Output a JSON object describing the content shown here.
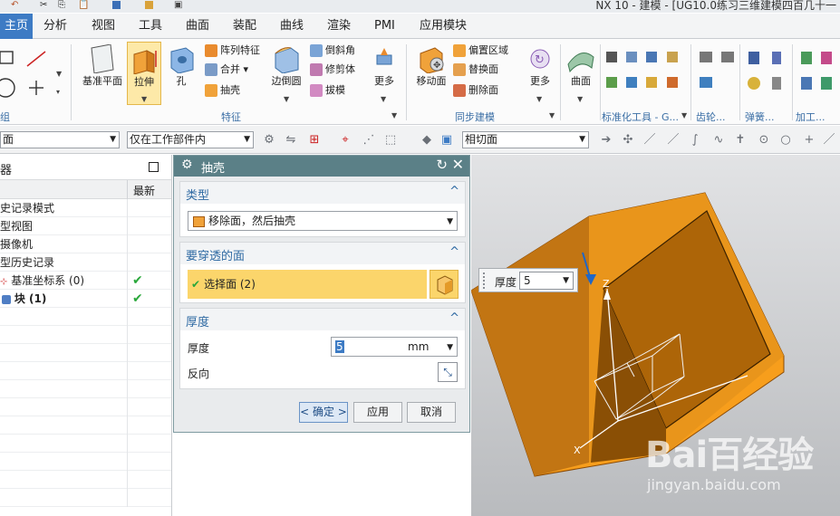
{
  "window": {
    "title": "NX 10 - 建模 - [UG10.0练习三维建模四百几十一"
  },
  "menu_tabs": [
    {
      "label": "主页",
      "active": true
    },
    {
      "label": "分析"
    },
    {
      "label": "视图"
    },
    {
      "label": "工具"
    },
    {
      "label": "曲面"
    },
    {
      "label": "装配"
    },
    {
      "label": "曲线"
    },
    {
      "label": "渲染"
    },
    {
      "label": "PMI"
    },
    {
      "label": "应用模块"
    }
  ],
  "ribbon": {
    "datum_plane": "基准平面",
    "extrude": "拉伸",
    "hole": "孔",
    "pattern_feature": "阵列特征",
    "unite": "合并",
    "shell": "抽壳",
    "edge_blend": "边倒圆",
    "chamfer": "倒斜角",
    "trim_body": "修剪体",
    "draft": "拔模",
    "more1": "更多",
    "group_feature": "特征",
    "move_face": "移动面",
    "offset_region": "偏置区域",
    "replace_face": "替换面",
    "delete_face": "删除面",
    "more2": "更多",
    "group_sync": "同步建模",
    "surface": "曲面",
    "group_std_parts": "标准化工具 - G...",
    "group_gear": "齿轮...",
    "group_spring": "弹簧...",
    "group_process": "加工...",
    "group_direct": "组"
  },
  "filterbar": {
    "type_filter": "面",
    "scope_filter": "仅在工作部件内",
    "face_rule": "相切面"
  },
  "navigator": {
    "title": "器",
    "col_latest": "最新",
    "rows": [
      {
        "label": "史记录模式",
        "check": ""
      },
      {
        "label": "型视图",
        "check": ""
      },
      {
        "label": "摄像机",
        "check": ""
      },
      {
        "label": "型历史记录",
        "check": ""
      },
      {
        "label": "基准坐标系 (0)",
        "check": "✔"
      },
      {
        "label": "块 (1)",
        "check": "✔"
      }
    ]
  },
  "dialog": {
    "title": "抽壳",
    "sec_type": "类型",
    "type_value": "移除面，然后抽壳",
    "sec_faces": "要穿透的面",
    "select_face": "选择面 (2)",
    "sec_thickness": "厚度",
    "thickness_label": "厚度",
    "thickness_value": "5",
    "thickness_unit": "mm",
    "reverse_label": "反向",
    "ok": "< 确定 >",
    "apply": "应用",
    "cancel": "取消"
  },
  "viewport": {
    "popup_label": "厚度",
    "popup_value": "5",
    "axis_z": "Z",
    "axis_x": "X"
  },
  "watermark": {
    "brand": "Bai百经验",
    "url": "jingyan.baidu.com"
  },
  "colors": {
    "accent": "#3d7bc4",
    "dialog_header": "#5b8087",
    "part_orange": "#f4a01f",
    "selection": "#fbd56b"
  }
}
